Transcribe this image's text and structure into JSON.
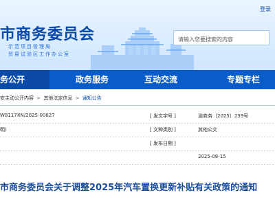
{
  "header": {
    "login_label": "登录",
    "org_title": "市商务委员会",
    "sub_line_1": "示范项目管理局",
    "sub_line_2": "贸易试验区工作办公室",
    "search": {
      "placeholder": "请输入您要搜索的内容"
    }
  },
  "nav": {
    "items": [
      {
        "label": "务公开"
      },
      {
        "label": "政务服务"
      },
      {
        "label": "互动交流"
      },
      {
        "label": "专题专栏"
      }
    ]
  },
  "breadcrumb": {
    "items": [
      {
        "label": "安主动公开内容"
      },
      {
        "label": "其他法定信息"
      },
      {
        "label": "通知公告"
      }
    ],
    "separator": ">"
  },
  "meta": {
    "rows": [
      {
        "left_value": "W8117XN/2025-00627",
        "right_key": "[ 发文字号 ]",
        "right_value": "渝商务〔2025〕239号"
      },
      {
        "left_value": "明)",
        "right_key": "[ 文种类别 ]",
        "right_value": "其他公文"
      },
      {
        "left_value": "",
        "right_key": "[ 发布日期 ]",
        "right_value": ""
      },
      {
        "left_value": "",
        "right_key": "",
        "right_value": "2025-08-15"
      }
    ]
  },
  "document": {
    "title": "市商务委员会关于调整2025年汽车置换更新补贴有关政策的通知"
  },
  "colors": {
    "primary": "#0a5cc8",
    "primary_dark": "#0b4aa7",
    "title_blue": "#1b4d9b",
    "header_bg": "#d7ebff"
  },
  "icons": {
    "landmark": "building-illustration"
  }
}
